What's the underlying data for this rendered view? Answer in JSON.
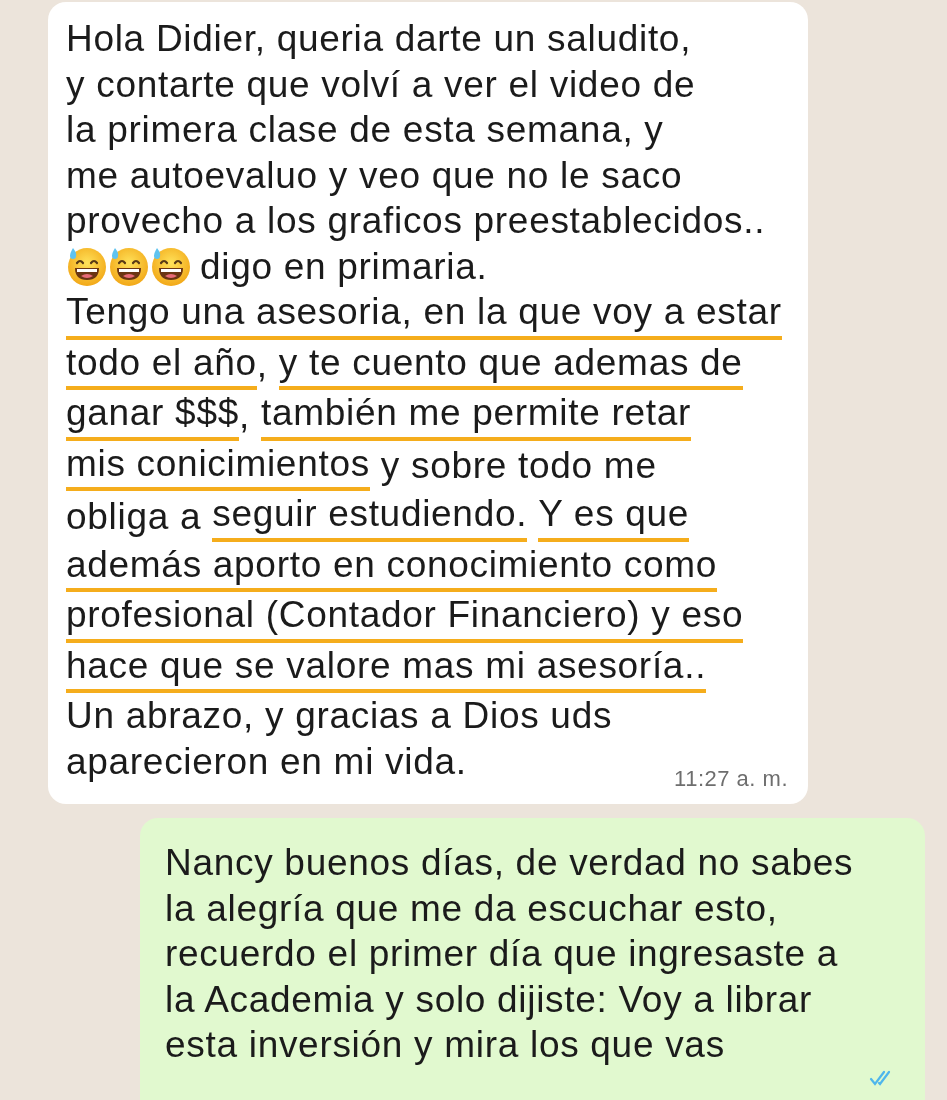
{
  "messages": [
    {
      "kind": "incoming",
      "time": "11:27 a. m.",
      "lines": [
        {
          "segments": [
            {
              "text": "Hola Didier, queria darte un saludito,",
              "underlined": false
            }
          ]
        },
        {
          "segments": [
            {
              "text": "y contarte que volví a ver el video de",
              "underlined": false
            }
          ]
        },
        {
          "segments": [
            {
              "text": "la primera clase de esta semana, y",
              "underlined": false
            }
          ]
        },
        {
          "segments": [
            {
              "text": "me autoevaluo y veo que no le saco",
              "underlined": false
            }
          ]
        },
        {
          "segments": [
            {
              "text": "provecho a los graficos preestablecidos..",
              "underlined": false
            }
          ]
        },
        {
          "segments": [
            {
              "kind": "emoji"
            },
            {
              "kind": "emoji"
            },
            {
              "kind": "emoji"
            },
            {
              "text": "digo en primaria.",
              "underlined": false
            }
          ]
        },
        {
          "segments": [
            {
              "text": "Tengo una asesoria, en la que voy a estar",
              "underlined": true
            }
          ]
        },
        {
          "segments": [
            {
              "text": "todo el año",
              "underlined": true
            },
            {
              "text": ", ",
              "underlined": false
            },
            {
              "text": "y te cuento que ademas de",
              "underlined": true
            }
          ]
        },
        {
          "segments": [
            {
              "text": "ganar $$$",
              "underlined": true
            },
            {
              "text": ", ",
              "underlined": false
            },
            {
              "text": "también me permite retar",
              "underlined": true
            }
          ]
        },
        {
          "segments": [
            {
              "text": "mis conicimientos",
              "underlined": true
            },
            {
              "text": " y sobre todo me",
              "underlined": false
            }
          ]
        },
        {
          "segments": [
            {
              "text": "obliga a ",
              "underlined": false
            },
            {
              "text": "seguir estudiendo.",
              "underlined": true
            },
            {
              "text": "Y es que",
              "underlined": true,
              "space_before": true
            }
          ]
        },
        {
          "segments": [
            {
              "text": "además aporto en conocimiento como",
              "underlined": true
            }
          ]
        },
        {
          "segments": [
            {
              "text": "profesional (Contador Financiero) y eso",
              "underlined": true
            }
          ]
        },
        {
          "segments": [
            {
              "text": "hace que se valore mas mi asesoría..",
              "underlined": true
            }
          ]
        },
        {
          "segments": [
            {
              "text": "Un abrazo, y gracias a Dios uds",
              "underlined": false
            }
          ]
        },
        {
          "segments": [
            {
              "text": "aparecieron en mi vida.",
              "underlined": false
            }
          ]
        }
      ]
    },
    {
      "kind": "outgoing",
      "read": true,
      "lines": [
        {
          "segments": [
            {
              "text": "Nancy buenos días, de verdad no sabes",
              "underlined": false
            }
          ]
        },
        {
          "segments": [
            {
              "text": "la alegría que me da escuchar esto,",
              "underlined": false
            }
          ]
        },
        {
          "segments": [
            {
              "text": "recuerdo el primer día que ingresaste a",
              "underlined": false
            }
          ]
        },
        {
          "segments": [
            {
              "text": "la Academia y solo dijiste: Voy a librar",
              "underlined": false
            }
          ]
        },
        {
          "segments": [
            {
              "text": "esta inversión y mira los que vas",
              "underlined": false
            }
          ]
        }
      ]
    }
  ]
}
